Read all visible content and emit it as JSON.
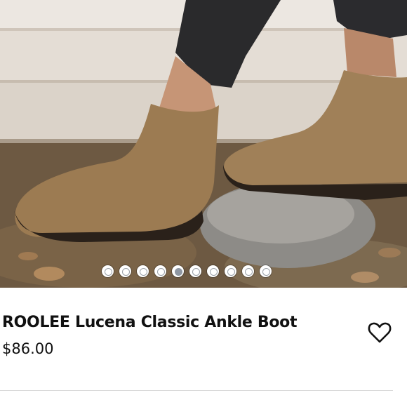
{
  "product": {
    "title": "ROOLEE Lucena Classic Ankle Boot",
    "price": "$86.00",
    "favorite_icon": "heart-outline-icon"
  },
  "carousel": {
    "image_count": 10,
    "active_index": 4
  },
  "colors": {
    "text": "#111111",
    "dot_active": "#8f97a3",
    "boot": "#9c7b52"
  }
}
